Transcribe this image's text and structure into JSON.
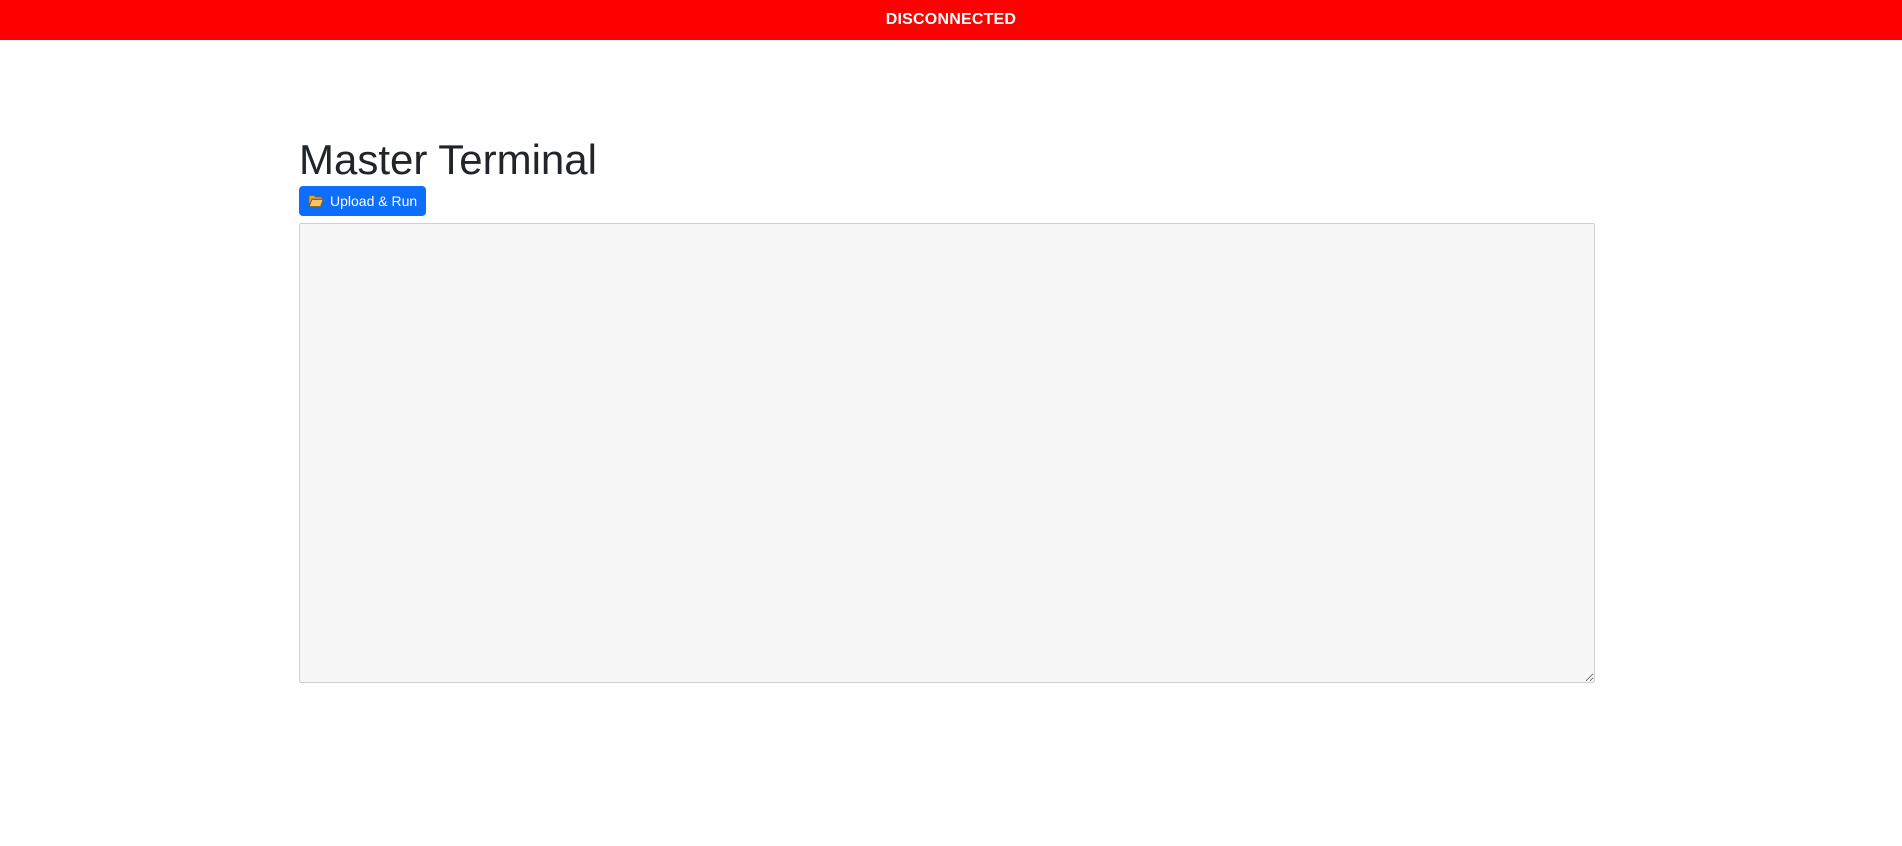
{
  "status": {
    "label": "DISCONNECTED",
    "color": "#ff0000"
  },
  "page": {
    "title": "Master Terminal"
  },
  "toolbar": {
    "upload_label": "Upload & Run",
    "upload_icon": "folder-open-icon",
    "button_color": "#0d6efd"
  },
  "terminal": {
    "value": "",
    "background": "#f7f7f7"
  }
}
